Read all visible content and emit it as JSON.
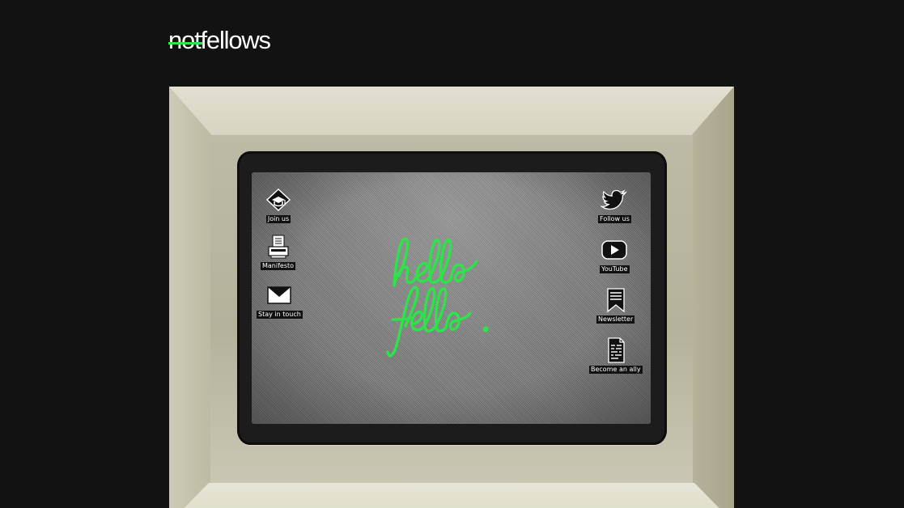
{
  "logo": {
    "struck": "not",
    "rest": "fellows"
  },
  "screen": {
    "greeting_line1": "hello",
    "greeting_line2": "fello.",
    "greeting_color": "#2ee34a"
  },
  "left_icons": [
    {
      "label": "Join us",
      "icon": "graduation-cap-icon"
    },
    {
      "label": "Manifesto",
      "icon": "printer-icon"
    },
    {
      "label": "Stay in touch",
      "icon": "envelope-icon"
    }
  ],
  "right_icons": [
    {
      "label": "Follow us",
      "icon": "twitter-bird-icon"
    },
    {
      "label": "YouTube",
      "icon": "youtube-play-icon"
    },
    {
      "label": "Newsletter",
      "icon": "bookmark-icon"
    },
    {
      "label": "Become an ally",
      "icon": "document-icon"
    }
  ],
  "colors": {
    "background": "#121212",
    "accent": "#2ee34a",
    "computer_beige": "#d9d8c8"
  }
}
